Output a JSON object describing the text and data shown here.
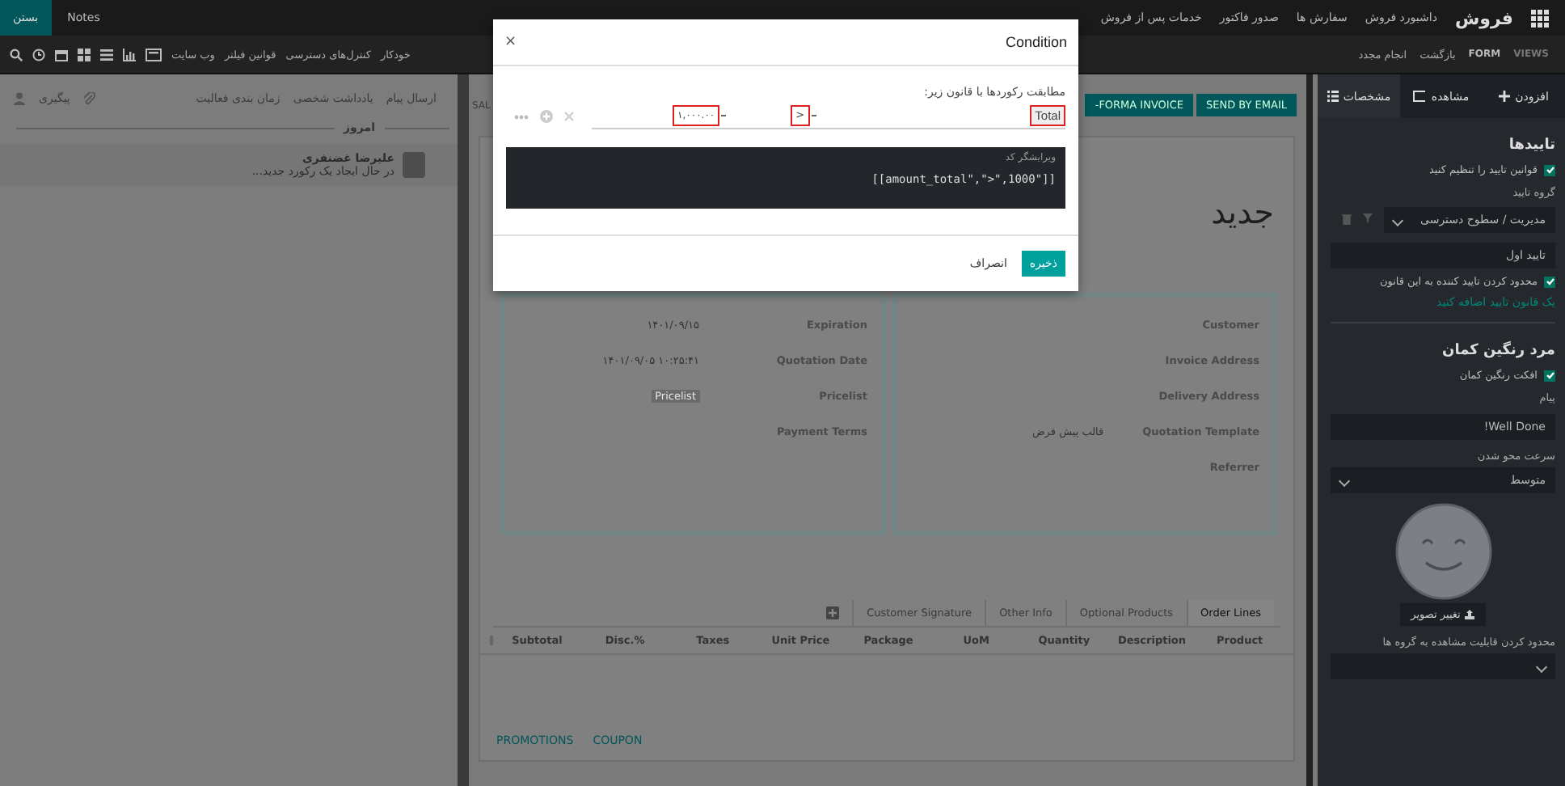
{
  "topbar": {
    "brand": "فروش",
    "menu": [
      "داشبورد فروش",
      "سفارش ها",
      "صدور فاکتور",
      "خدمات پس از فروش"
    ],
    "close_button": "بستن",
    "notes": "Notes"
  },
  "studio_bar": {
    "breadcrumb": [
      "VIEWS",
      "FORM"
    ],
    "undo": "بازگشت",
    "redo": "انجام مجدد",
    "links": [
      "خودکار",
      "کنترل‌های دسترسی",
      "قوانین فیلتر",
      "وب سایت"
    ]
  },
  "chatter": {
    "actions": [
      "ارسال پیام",
      "یادداشت شخصی",
      "زمان بندی فعالیت"
    ],
    "follow": "پیگیری",
    "date_separator": "امروز",
    "message": {
      "author": "علیرضا غضنفری",
      "body": "در حال ایجاد یک رکورد جدید..."
    }
  },
  "form": {
    "status": "SAL",
    "buttons": [
      "SEND BY EMAIL",
      "-FORMA INVOICE"
    ],
    "title": "جدید",
    "right_group": [
      {
        "label": "Customer"
      },
      {
        "label": "Invoice Address"
      },
      {
        "label": "Delivery Address"
      },
      {
        "label": "Quotation Template",
        "value": "قالب پیش فرض"
      },
      {
        "label": "Referrer"
      }
    ],
    "left_group": [
      {
        "label": "Expiration",
        "value": "۱۴۰۱/۰۹/۱۵"
      },
      {
        "label": "Quotation Date",
        "value": "۱۴۰۱/۰۹/۰۵ ۱۰:۲۵:۴۱"
      },
      {
        "label": "Pricelist",
        "placeholder": "Pricelist"
      },
      {
        "label": "Payment Terms"
      }
    ],
    "tabs": [
      {
        "label": "Order Lines",
        "selected": true
      },
      {
        "label": "Optional Products",
        "selected": false
      },
      {
        "label": "Other Info",
        "selected": false
      },
      {
        "label": "Customer Signature",
        "selected": false
      }
    ],
    "columns": [
      "Product",
      "Description",
      "Quantity",
      "UoM",
      "Package",
      "Unit Price",
      "Taxes",
      "%.Disc",
      "Subtotal"
    ],
    "links": [
      "COUPON",
      "PROMOTIONS"
    ]
  },
  "modal": {
    "title": "Condition",
    "close": "×",
    "intro": "مطابقت رکوردها با قانون زیر:",
    "field": "Total",
    "operator": ">",
    "value": "۱,۰۰۰.۰۰",
    "editor_label": "ویرایشگر کد",
    "code": "[[amount_total\",\">\",1000\"]]",
    "buttons": [
      {
        "label": "ذخیره",
        "kind": "primary"
      },
      {
        "label": "انصراف",
        "kind": "secondary"
      }
    ]
  },
  "sidebar": {
    "tabs": [
      {
        "label": "افزودن",
        "kind": "add",
        "selected": false
      },
      {
        "label": "مشاهده",
        "kind": "view",
        "selected": false
      },
      {
        "label": "مشخصات",
        "kind": "props",
        "selected": true
      }
    ],
    "items": [
      {
        "kind": "heading",
        "text": "تاییدها"
      },
      {
        "kind": "checkbox",
        "text": "قوانین تایید را تنظیم کنید",
        "checked": true
      },
      {
        "kind": "label",
        "text": "گروه تایید"
      },
      {
        "kind": "group_select",
        "text": "مدیریت / سطوح دسترسی"
      },
      {
        "kind": "input",
        "text": "تایید اول"
      },
      {
        "kind": "checkbox",
        "text": "محدود کردن تایید کننده به این قانون",
        "checked": true
      },
      {
        "kind": "link",
        "text": "یک قانون تایید اضافه کنید"
      },
      {
        "kind": "divider"
      },
      {
        "kind": "heading",
        "text": "مرد رنگین کمان"
      },
      {
        "kind": "checkbox",
        "text": "افکت رنگین کمان",
        "checked": true
      },
      {
        "kind": "label",
        "text": "پیام"
      },
      {
        "kind": "input",
        "text": "Well Done!"
      },
      {
        "kind": "label",
        "text": "سرعت محو شدن"
      },
      {
        "kind": "select",
        "text": "متوسط"
      },
      {
        "kind": "image"
      },
      {
        "kind": "button",
        "text": "تغییر تصویر"
      },
      {
        "kind": "label",
        "text": "محدود کردن قابلیت مشاهده به گروه ها"
      },
      {
        "kind": "select"
      }
    ]
  }
}
